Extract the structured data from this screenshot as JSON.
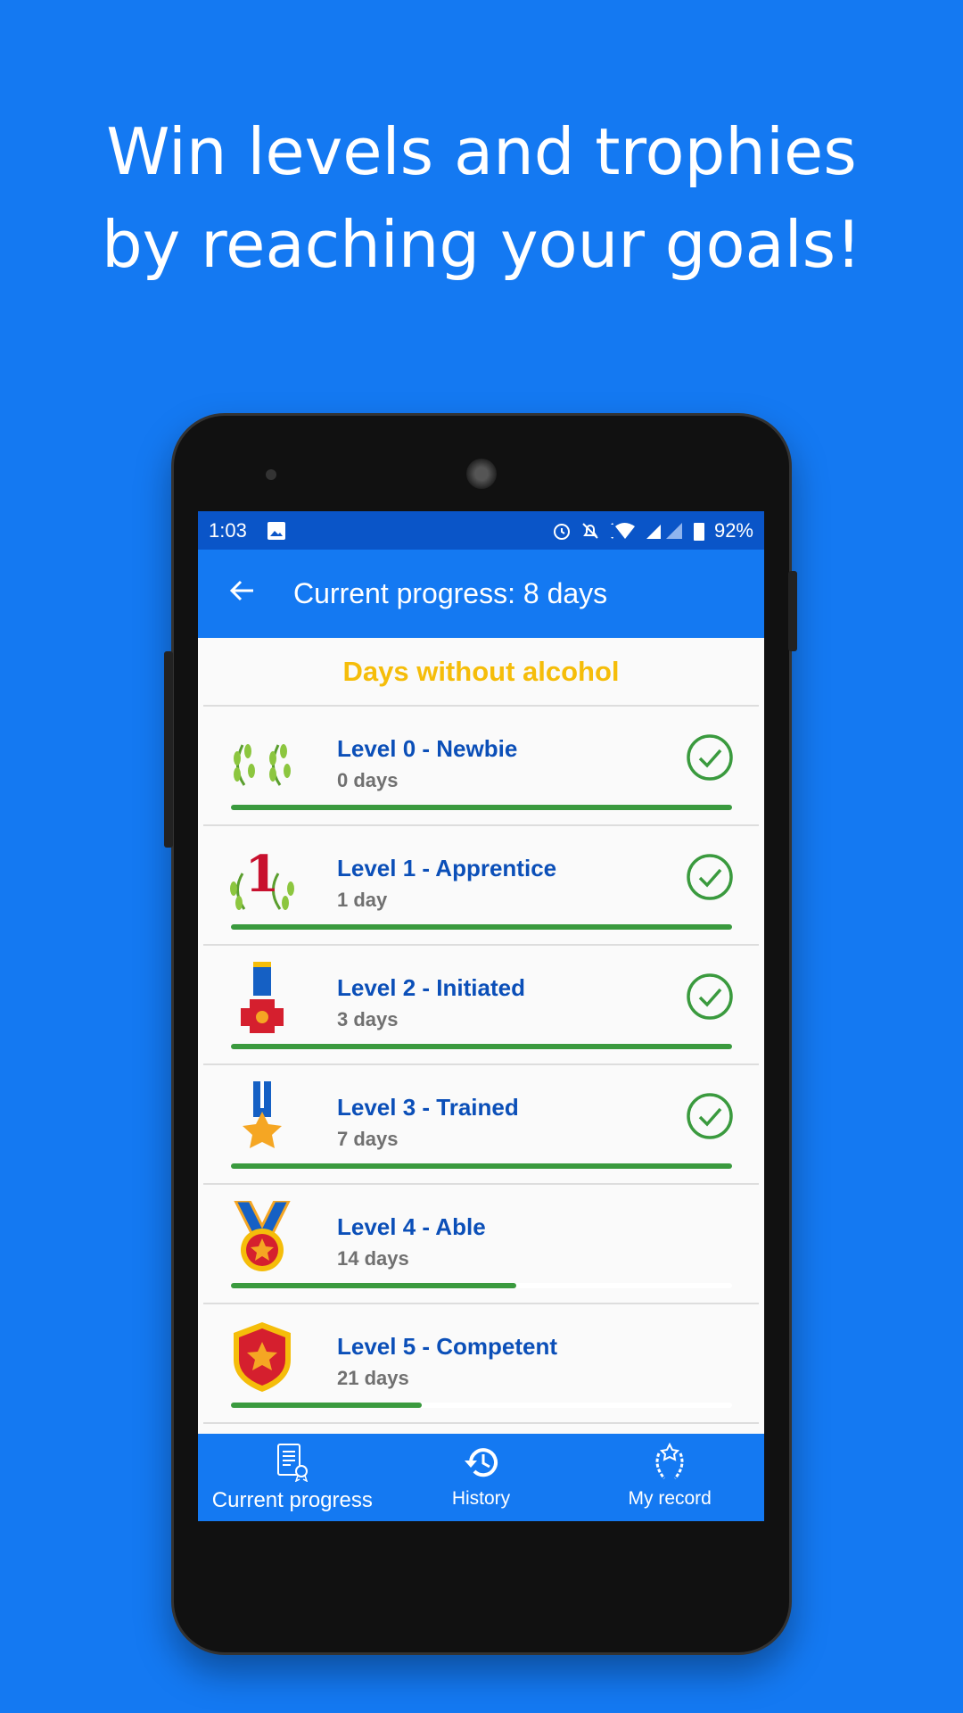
{
  "headline": {
    "line1": "Win levels and trophies",
    "line2": "by reaching your goals!"
  },
  "status_bar": {
    "time": "1:03",
    "battery": "92%"
  },
  "app_bar": {
    "title": "Current progress: 8 days"
  },
  "section_title": "Days without alcohol",
  "colors": {
    "background": "#1479f2",
    "section_title": "#f5bd0a",
    "level_name": "#0b4fb8",
    "progress": "#3a9a3e"
  },
  "levels": [
    {
      "name": "Level 0 - Newbie",
      "days": "0 days",
      "progress": 1,
      "completed": true,
      "icon": "laurel-icon"
    },
    {
      "name": "Level 1 - Apprentice",
      "days": "1 day",
      "progress": 1,
      "completed": true,
      "icon": "laurel-number-one-icon"
    },
    {
      "name": "Level 2 - Initiated",
      "days": "3 days",
      "progress": 1,
      "completed": true,
      "icon": "cross-medal-icon"
    },
    {
      "name": "Level 3 - Trained",
      "days": "7 days",
      "progress": 1,
      "completed": true,
      "icon": "star-medal-icon"
    },
    {
      "name": "Level 4 - Able",
      "days": "14 days",
      "progress": 0.57,
      "completed": false,
      "icon": "round-medal-icon"
    },
    {
      "name": "Level 5 - Competent",
      "days": "21 days",
      "progress": 0.38,
      "completed": false,
      "icon": "shield-star-icon"
    }
  ],
  "bottom_nav": [
    {
      "label": "Current progress",
      "icon": "certificate-icon",
      "active": true
    },
    {
      "label": "History",
      "icon": "history-icon",
      "active": false
    },
    {
      "label": "My record",
      "icon": "laurel-star-icon",
      "active": false
    }
  ]
}
